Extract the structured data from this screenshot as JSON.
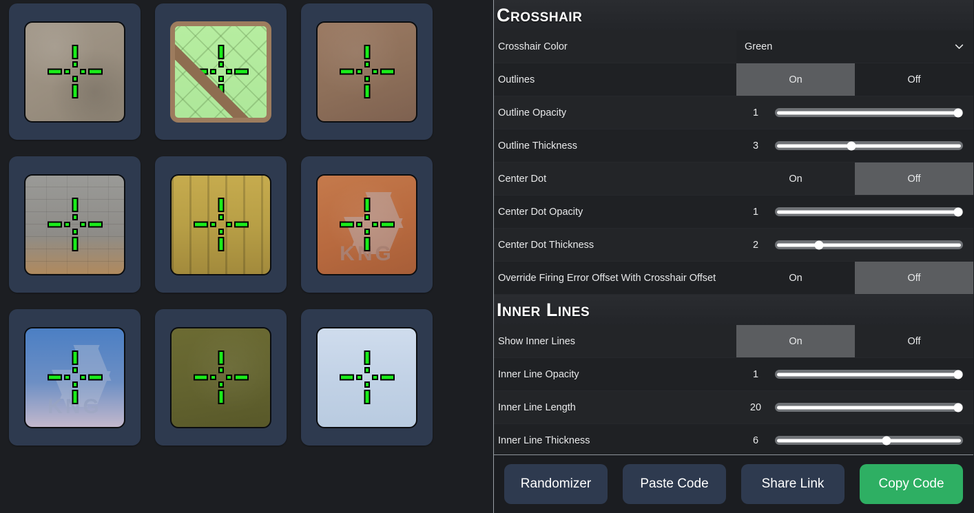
{
  "gallery": {
    "tiles": [
      {
        "name": "preview-sand",
        "backdrop": "sand"
      },
      {
        "name": "preview-lattice",
        "backdrop": "lattice"
      },
      {
        "name": "preview-brown",
        "backdrop": "brown"
      },
      {
        "name": "preview-stone",
        "backdrop": "stone"
      },
      {
        "name": "preview-wood",
        "backdrop": "wood"
      },
      {
        "name": "preview-orange",
        "backdrop": "orange",
        "watermark": "KNG"
      },
      {
        "name": "preview-sky",
        "backdrop": "sky",
        "watermark": "KNG"
      },
      {
        "name": "preview-olive",
        "backdrop": "olive"
      },
      {
        "name": "preview-pale",
        "backdrop": "pale"
      }
    ]
  },
  "panel": {
    "sections": [
      {
        "title": "Crosshair",
        "rows": [
          {
            "label": "Crosshair Color",
            "type": "select",
            "value": "Green"
          },
          {
            "label": "Outlines",
            "type": "toggle",
            "on_label": "On",
            "off_label": "Off",
            "value": "On"
          },
          {
            "label": "Outline Opacity",
            "type": "slider",
            "value": "1",
            "percent": 100
          },
          {
            "label": "Outline Thickness",
            "type": "slider",
            "value": "3",
            "percent": 40
          },
          {
            "label": "Center Dot",
            "type": "toggle",
            "on_label": "On",
            "off_label": "Off",
            "value": "Off"
          },
          {
            "label": "Center Dot Opacity",
            "type": "slider",
            "value": "1",
            "percent": 100
          },
          {
            "label": "Center Dot Thickness",
            "type": "slider",
            "value": "2",
            "percent": 22
          },
          {
            "label": "Override Firing Error Offset With Crosshair Offset",
            "type": "toggle",
            "on_label": "On",
            "off_label": "Off",
            "value": "Off"
          }
        ]
      },
      {
        "title": "Inner Lines",
        "rows": [
          {
            "label": "Show Inner Lines",
            "type": "toggle",
            "on_label": "On",
            "off_label": "Off",
            "value": "On"
          },
          {
            "label": "Inner Line Opacity",
            "type": "slider",
            "value": "1",
            "percent": 100
          },
          {
            "label": "Inner Line Length",
            "type": "slider",
            "value": "20",
            "percent": 100
          },
          {
            "label": "Inner Line Thickness",
            "type": "slider",
            "value": "6",
            "percent": 60
          }
        ]
      }
    ]
  },
  "footer": {
    "buttons": [
      {
        "label": "Randomizer",
        "name": "randomizer-button",
        "primary": false
      },
      {
        "label": "Paste Code",
        "name": "paste-code-button",
        "primary": false
      },
      {
        "label": "Share Link",
        "name": "share-link-button",
        "primary": false
      },
      {
        "label": "Copy Code",
        "name": "copy-code-button",
        "primary": true
      }
    ]
  },
  "colors": {
    "accent_green": "#2eaf63",
    "crosshair_green": "#1aec1a",
    "card_slate": "#2e3a4f",
    "toggle_active": "#5b5d60"
  }
}
